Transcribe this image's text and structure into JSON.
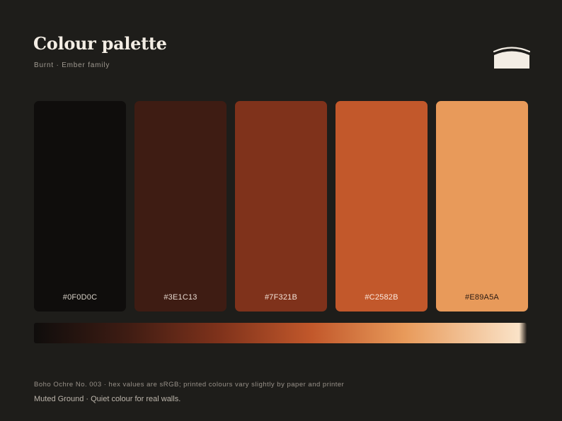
{
  "header": {
    "title": "Colour palette",
    "subtitle": "Burnt · Ember family"
  },
  "logo": {
    "icon": "arch-logo-icon",
    "color": "#f3ede4"
  },
  "swatches": [
    {
      "hex": "#0F0D0C",
      "label_color": "#d8d2c8"
    },
    {
      "hex": "#3E1C13",
      "label_color": "#e6d9d0"
    },
    {
      "hex": "#7F321B",
      "label_color": "#f3e3d8"
    },
    {
      "hex": "#C2582B",
      "label_color": "#fbe9de"
    },
    {
      "hex": "#E89A5A",
      "label_color": "#2a1a12"
    }
  ],
  "gradient": {
    "stops": [
      "#0F0D0C",
      "#3E1C13",
      "#7F321B",
      "#C2582B",
      "#E89A5A",
      "#FAE3C8"
    ]
  },
  "footer": {
    "footnote": "Boho Ochre No. 003 · hex values are sRGB; printed colours vary slightly by paper and printer",
    "tagline": "Muted Ground · Quiet colour for real walls."
  }
}
